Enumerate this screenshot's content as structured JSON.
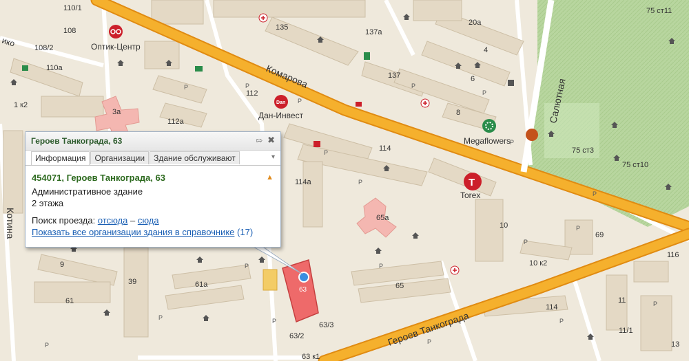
{
  "map": {
    "streets": {
      "komarova": "Комарова",
      "salyutnaya": "Салютная",
      "kotina": "Котина",
      "geroev": "Героев Танкограда",
      "small_1": "ико"
    },
    "pois": {
      "optik": "Оптик-Центр",
      "dan": "Дан-Инвест",
      "megaflowers": "Megaflowers",
      "torex": "Torex"
    },
    "house_numbers": {
      "n110_1": "110/1",
      "n108": "108",
      "n108_2": "108/2",
      "n110a": "110а",
      "n1k2": "1 к2",
      "n3a": "3а",
      "n112": "112",
      "n112a": "112а",
      "n135": "135",
      "n137a": "137а",
      "n137": "137",
      "n20a": "20а",
      "n4": "4",
      "n6": "6",
      "n8": "8",
      "n75st11": "75 ст11",
      "n75st3": "75 ст3",
      "n75st10": "75 ст10",
      "n114": "114",
      "n114a": "114а",
      "n65a": "65а",
      "n10": "10",
      "n69": "69",
      "n10k2": "10 к2",
      "n9": "9",
      "n39": "39",
      "n61a": "61а",
      "n61": "61",
      "n65": "65",
      "n63": "63",
      "n63_3": "63/3",
      "n63_2": "63/2",
      "n63k1": "63 к1",
      "n114b": "114",
      "n13": "13",
      "n11": "11",
      "n11_1": "11/1",
      "n116": "116",
      "p": "P"
    }
  },
  "popup": {
    "title": "Героев Танкограда, 63",
    "tabs": [
      "Информация",
      "Организации",
      "Здание обслуживают"
    ],
    "address": "454071, Героев Танкограда, 63",
    "building_type": "Административное здание",
    "floors": "2 этажа",
    "route_label": "Поиск проезда:",
    "route_from": "отсюда",
    "route_dash": "–",
    "route_to": "сюда",
    "all_orgs_link": "Показать все организации здания в справочнике",
    "org_count": "(17)"
  },
  "colors": {
    "road_main": "#f5a623",
    "road_main_border": "#e28a0c",
    "background": "#efe9dc",
    "building": "#e6dcc9",
    "park": "#b9dca1",
    "highlight": "#ee6a6a",
    "poi_red": "#cc1f2a"
  }
}
